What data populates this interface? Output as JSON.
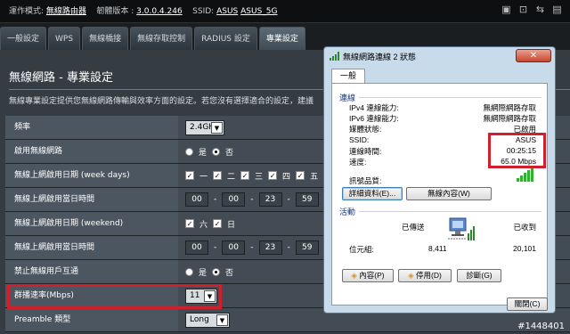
{
  "topbar": {
    "mode_label": "運作模式:",
    "mode_value": "無線路由器",
    "firmware_label": "韌體版本 :",
    "firmware_value": "3.0.0.4.246",
    "ssid_label": "SSID:",
    "ssid_1": "ASUS",
    "ssid_2": "ASUS_5G"
  },
  "tabs": [
    "一般設定",
    "WPS",
    "無線橋接",
    "無線存取控制",
    "RADIUS 設定",
    "專業設定"
  ],
  "section": {
    "title": "無線網路 - 專業設定",
    "description": "無線專業設定提供您無線網路傳輸與效率方面的設定。若您沒有選擇適合的設定，建議"
  },
  "rows": {
    "band": {
      "label": "頻率",
      "value": "2.4GHz"
    },
    "enable": {
      "label": "啟用無線網路",
      "yes": "是",
      "no": "否"
    },
    "weekdays": {
      "label": "無線上網啟用日期 (week days)",
      "days": [
        "一",
        "二",
        "三",
        "四",
        "五"
      ]
    },
    "weekday_time": {
      "label": "無線上網啟用當日時間",
      "t1": "00",
      "t2": "00",
      "t3": "23",
      "t4": "59"
    },
    "weekend": {
      "label": "無線上網啟用日期 (weekend)",
      "days": [
        "六",
        "日"
      ]
    },
    "weekend_time": {
      "label": "無線上網啟用當日時間",
      "t1": "00",
      "t2": "00",
      "t3": "23",
      "t4": "59"
    },
    "ap_isolate": {
      "label": "禁止無線用戶互通",
      "yes": "是",
      "no": "否"
    },
    "multicast": {
      "label": "群播速率(Mbps)",
      "value": "11"
    },
    "preamble": {
      "label": "Preamble 類型",
      "value": "Long"
    }
  },
  "dialog": {
    "title": "無線網路連線 2 狀態",
    "close": "✕",
    "tab": "一般",
    "connection_group": "連線",
    "ipv4_label": "IPv4 連線能力:",
    "ipv4_value": "無網際網路存取",
    "ipv6_label": "IPv6 連線能力:",
    "ipv6_value": "無網際網路存取",
    "media_label": "媒體狀態:",
    "media_value": "已啟用",
    "ssid_label": "SSID:",
    "ssid_value": "ASUS",
    "duration_label": "連線時間:",
    "duration_value": "00:25:15",
    "speed_label": "速度:",
    "speed_value": "65.0 Mbps",
    "signal_label": "訊號品質:",
    "details_button": "詳細資料(E)...",
    "wireless_props_button": "無線內容(W)",
    "activity_group": "活動",
    "sent_label": "已傳送",
    "received_label": "已收到",
    "bytes_label": "位元組:",
    "bytes_sent": "8,411",
    "bytes_received": "20,101",
    "properties_button": "內容(P)",
    "disable_button": "停用(D)",
    "diagnose_button": "診斷(G)",
    "close_button": "關閉(C)"
  },
  "watermark": "#1448401",
  "colors": {
    "highlight": "#d0202b",
    "panel": "#353d43",
    "label_bg": "#4b5660"
  }
}
